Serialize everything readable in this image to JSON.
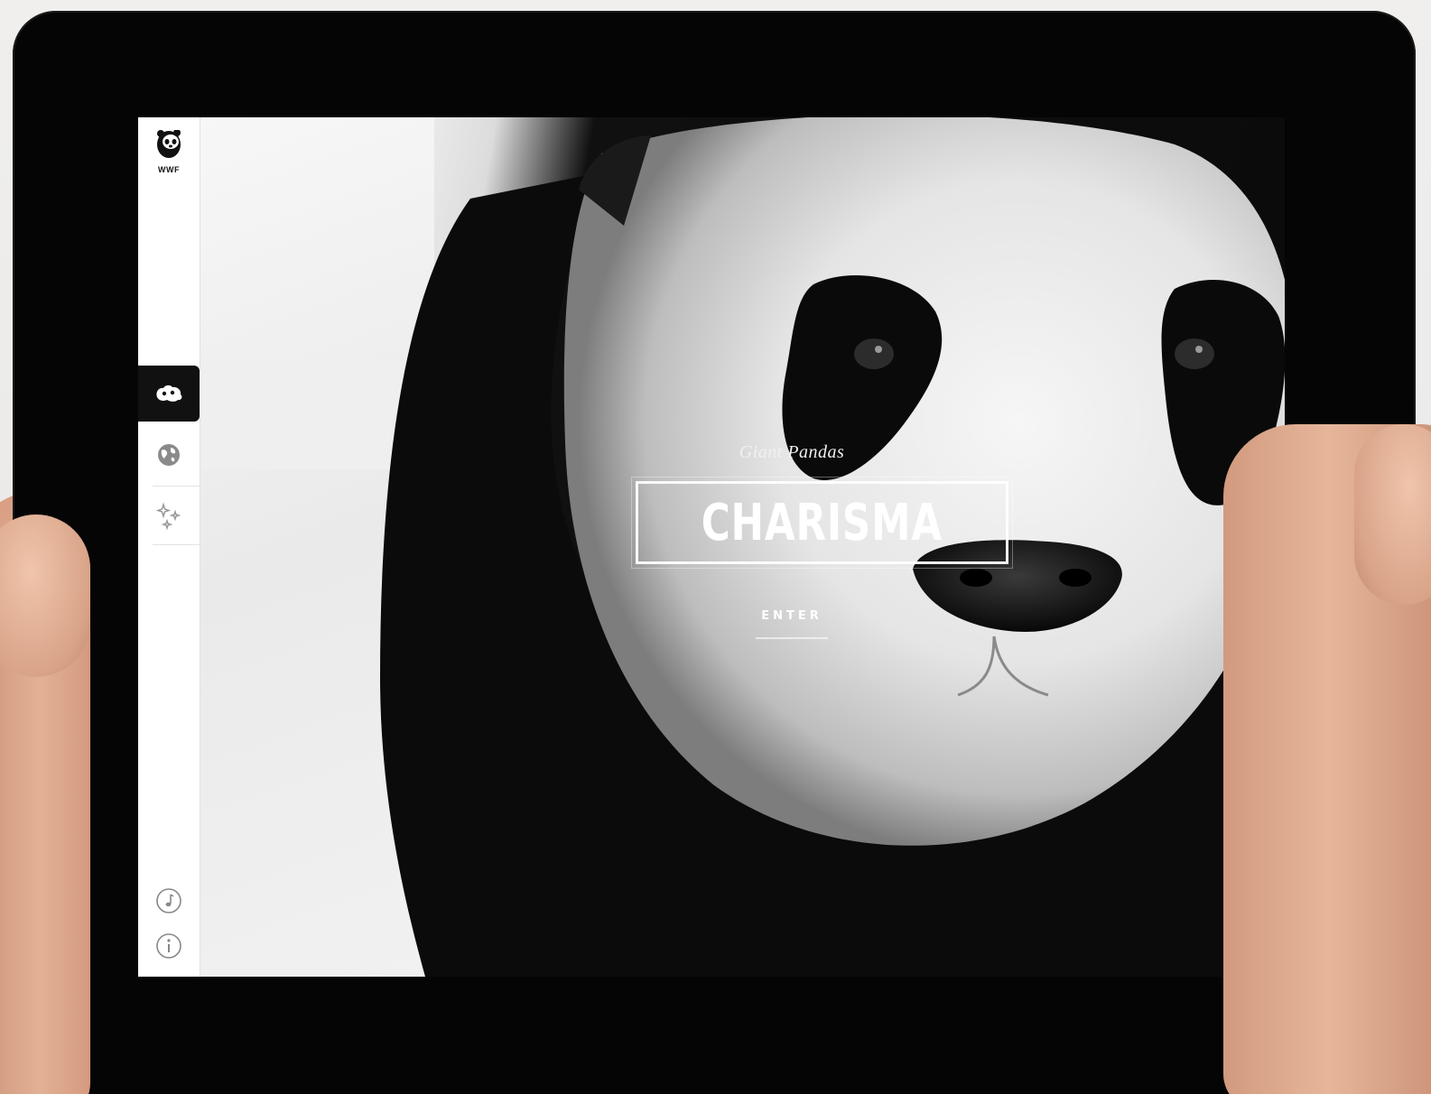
{
  "app": {
    "logo_text": "WWF"
  },
  "sidebar": {
    "items": [
      {
        "name": "panda-section",
        "icon": "panda-icon",
        "active": true
      },
      {
        "name": "globe-section",
        "icon": "globe-icon",
        "active": false
      },
      {
        "name": "sparkle-section",
        "icon": "sparkle-icon",
        "active": false
      }
    ],
    "bottom": [
      {
        "name": "music",
        "icon": "music-note-icon"
      },
      {
        "name": "info",
        "icon": "info-icon"
      }
    ]
  },
  "hero": {
    "subtitle": "Giant Pandas",
    "title": "CHARISMA",
    "enter_label": "ENTER"
  },
  "colors": {
    "sidebar_bg": "#ffffff",
    "active_item_bg": "#111111",
    "bezel": "#050505",
    "text_on_photo": "#ffffff"
  }
}
